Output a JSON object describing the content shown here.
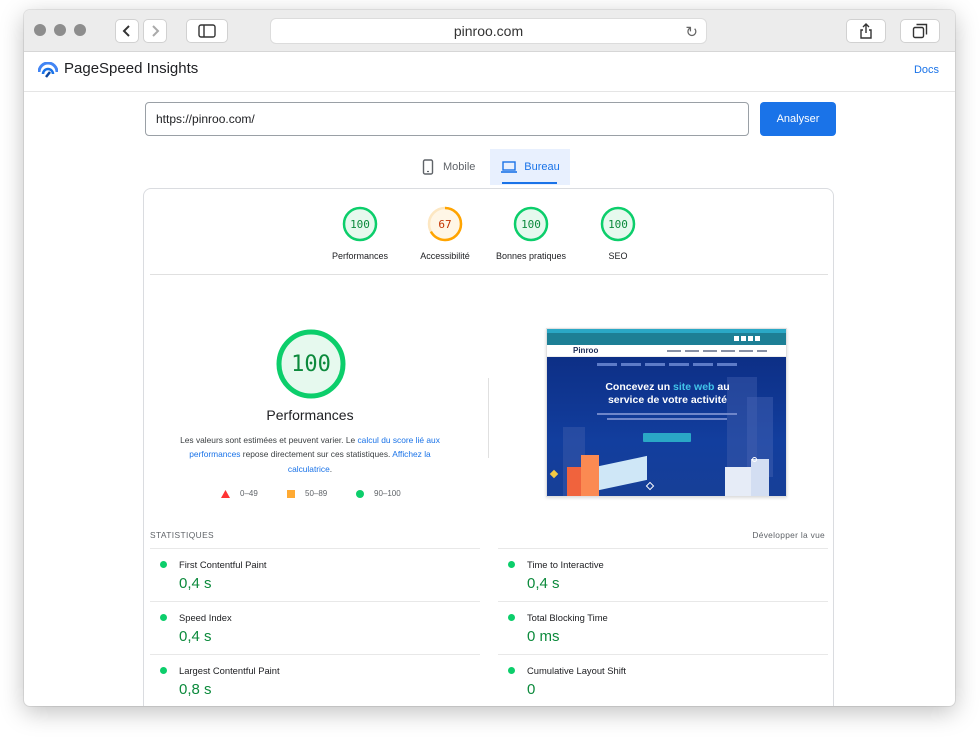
{
  "browser": {
    "url": "pinroo.com"
  },
  "app": {
    "title": "PageSpeed Insights",
    "docs_label": "Docs"
  },
  "search": {
    "value": "https://pinroo.com/",
    "analyse_label": "Analyser"
  },
  "tabs": [
    {
      "label": "Mobile",
      "selected": false
    },
    {
      "label": "Bureau",
      "selected": true
    }
  ],
  "scores": [
    {
      "value": "100",
      "label": "Performances",
      "score": 100,
      "status": "pass"
    },
    {
      "value": "67",
      "label": "Accessibilité",
      "score": 67,
      "status": "average"
    },
    {
      "value": "100",
      "label": "Bonnes pratiques",
      "score": 100,
      "status": "pass"
    },
    {
      "value": "100",
      "label": "SEO",
      "score": 100,
      "status": "pass"
    }
  ],
  "performance": {
    "score": "100",
    "title": "Performances",
    "desc_1": "Les valeurs sont estimées et peuvent varier. Le ",
    "desc_link_1": "calcul du score lié aux performances",
    "desc_2": " repose directement sur ces statistiques. ",
    "desc_link_2": "Affichez la calculatrice",
    "desc_3": "."
  },
  "legend": [
    {
      "shape": "triangle",
      "range": "0–49",
      "color": "#ff3333"
    },
    {
      "shape": "square",
      "range": "50–89",
      "color": "#ffaa33"
    },
    {
      "shape": "circle",
      "range": "90–100",
      "color": "#0cce6b"
    }
  ],
  "screenshot": {
    "logo": "Pinroo",
    "headline_1": "Concevez un ",
    "headline_highlight": "site web",
    "headline_2": " au",
    "headline_3": "service de votre activité"
  },
  "stats": {
    "heading": "STATISTIQUES",
    "expand_label": "Développer la vue",
    "metrics": [
      {
        "name": "First Contentful Paint",
        "value": "0,4 s"
      },
      {
        "name": "Time to Interactive",
        "value": "0,4 s"
      },
      {
        "name": "Speed Index",
        "value": "0,4 s"
      },
      {
        "name": "Total Blocking Time",
        "value": "0 ms"
      },
      {
        "name": "Largest Contentful Paint",
        "value": "0,8 s"
      },
      {
        "name": "Cumulative Layout Shift",
        "value": "0"
      }
    ]
  },
  "colors": {
    "pass": "#0cce6b",
    "pass_text": "#0c8a3c",
    "average": "#ffa400",
    "average_text": "#c33300",
    "accent": "#1a73e8"
  }
}
